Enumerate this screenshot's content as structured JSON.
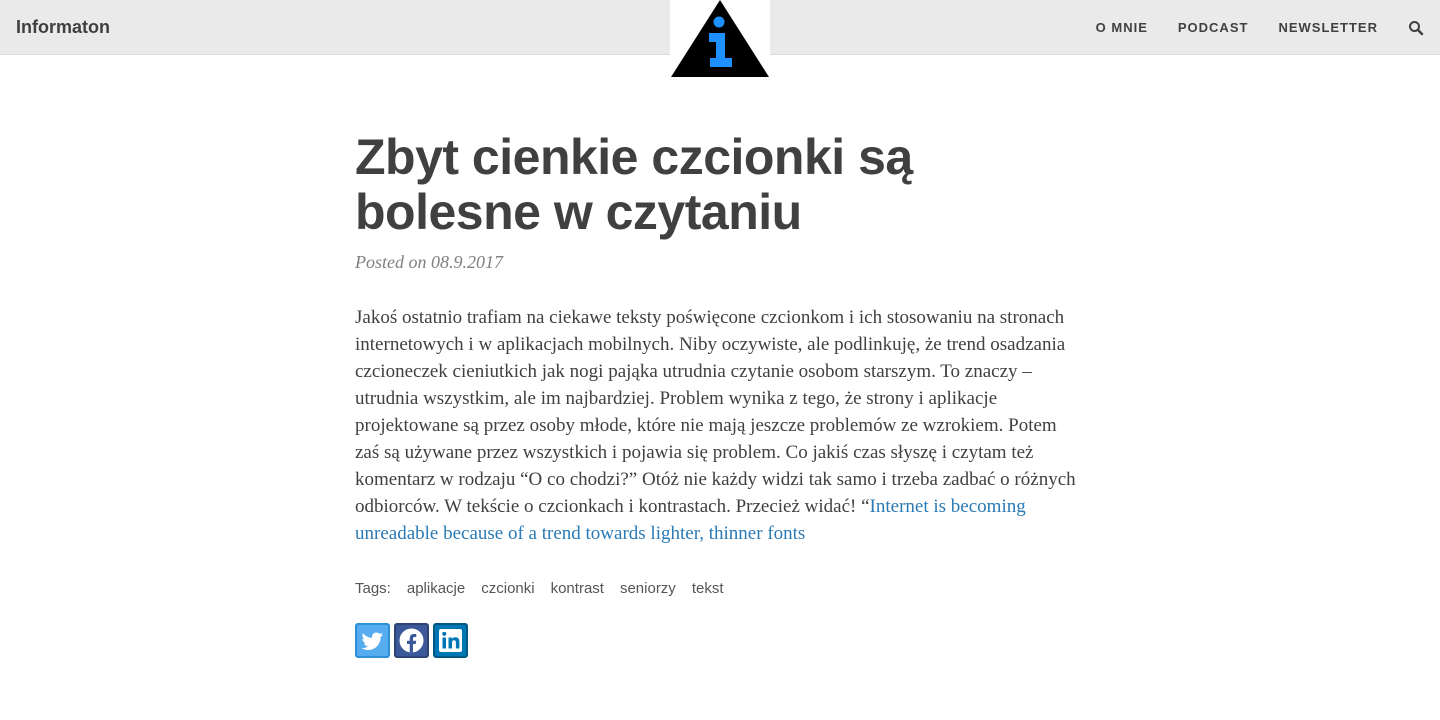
{
  "header": {
    "brand": "Informaton",
    "nav": [
      "O MNIE",
      "PODCAST",
      "NEWSLETTER"
    ],
    "search_icon": "search-icon",
    "logo_colors": {
      "triangle": "#000000",
      "letter": "#1e90ff"
    }
  },
  "post": {
    "title": "Zbyt cienkie czcionki są bolesne w czytaniu",
    "posted": "Posted on 08.9.2017",
    "body": "Jakoś ostatnio trafiam na ciekawe teksty poświęcone czcionkom i ich stosowaniu na stronach internetowych i w aplikacjach mobilnych. Niby oczywiste, ale podlinkuję, że trend osadzania czcioneczek cieniutkich jak nogi pająka utrudnia czytanie osobom starszym. To znaczy – utrudnia wszystkim, ale im najbardziej. Problem wynika z tego, że strony i aplikacje projektowane są przez osoby młode, które nie mają jeszcze problemów ze wzrokiem. Potem zaś są używane przez wszystkich i pojawia się problem. Co jakiś czas słyszę i czytam też komentarz w rodzaju “O co chodzi?” Otóż nie każdy widzi tak samo i trzeba zadbać o różnych odbiorców. W tekście o czcionkach i kontrastach. Przecież widać! “",
    "link": "Internet is becoming unreadable because of a trend towards lighter, thinner fonts",
    "tags_label": "Tags:",
    "tags": [
      "aplikacje",
      "czcionki",
      "kontrast",
      "seniorzy",
      "tekst"
    ],
    "share": [
      {
        "icon": "twitter-icon",
        "color": "#55acee"
      },
      {
        "icon": "facebook-icon",
        "color": "#3b5998"
      },
      {
        "icon": "linkedin-icon",
        "color": "#0077b5"
      }
    ]
  }
}
